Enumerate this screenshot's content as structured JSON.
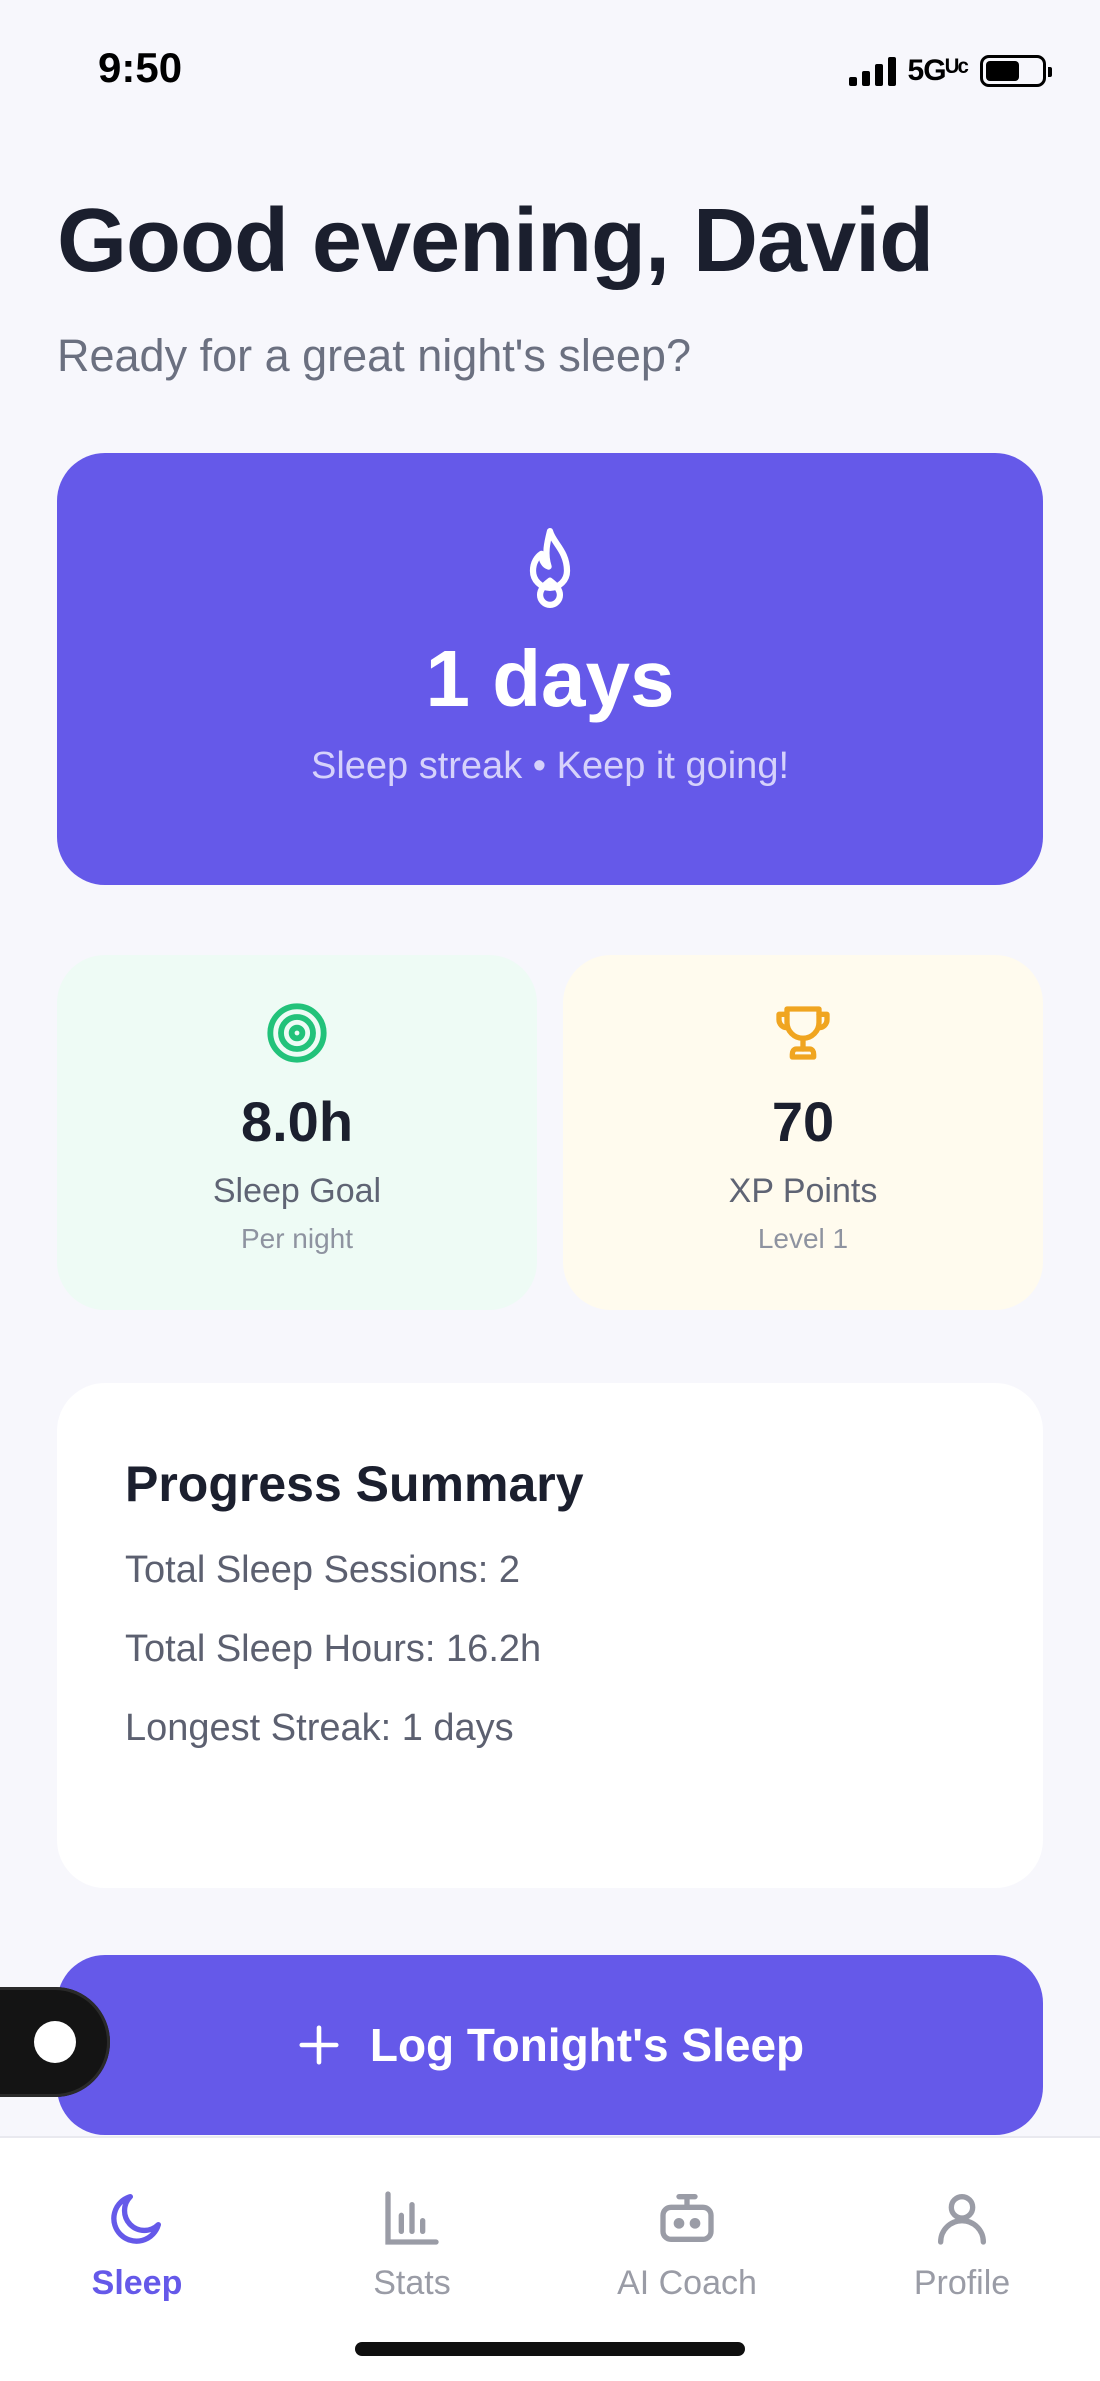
{
  "status_bar": {
    "time": "9:50",
    "network": "5Gᵁᶜ"
  },
  "greeting": {
    "title": "Good evening, David",
    "subtitle": "Ready for a great night's sleep?"
  },
  "streak": {
    "value": "1 days",
    "caption": "Sleep streak • Keep it going!"
  },
  "stats": {
    "goal": {
      "value": "8.0h",
      "label": "Sleep Goal",
      "sub": "Per night",
      "icon": "target-icon",
      "color": "#22c27a"
    },
    "xp": {
      "value": "70",
      "label": "XP Points",
      "sub": "Level 1",
      "icon": "trophy-icon",
      "color": "#f0a520"
    }
  },
  "summary": {
    "title": "Progress Summary",
    "lines": [
      "Total Sleep Sessions: 2",
      "Total Sleep Hours: 16.2h",
      "Longest Streak: 1 days"
    ]
  },
  "log_button": {
    "label": "Log Tonight's Sleep",
    "icon": "plus-icon"
  },
  "tabs": [
    {
      "label": "Sleep",
      "icon": "moon-icon",
      "active": true
    },
    {
      "label": "Stats",
      "icon": "bar-chart-icon",
      "active": false
    },
    {
      "label": "AI Coach",
      "icon": "robot-icon",
      "active": false
    },
    {
      "label": "Profile",
      "icon": "user-icon",
      "active": false
    }
  ],
  "colors": {
    "accent": "#6559e9",
    "background": "#f7f7fc",
    "inactive": "#9a9ca6"
  }
}
